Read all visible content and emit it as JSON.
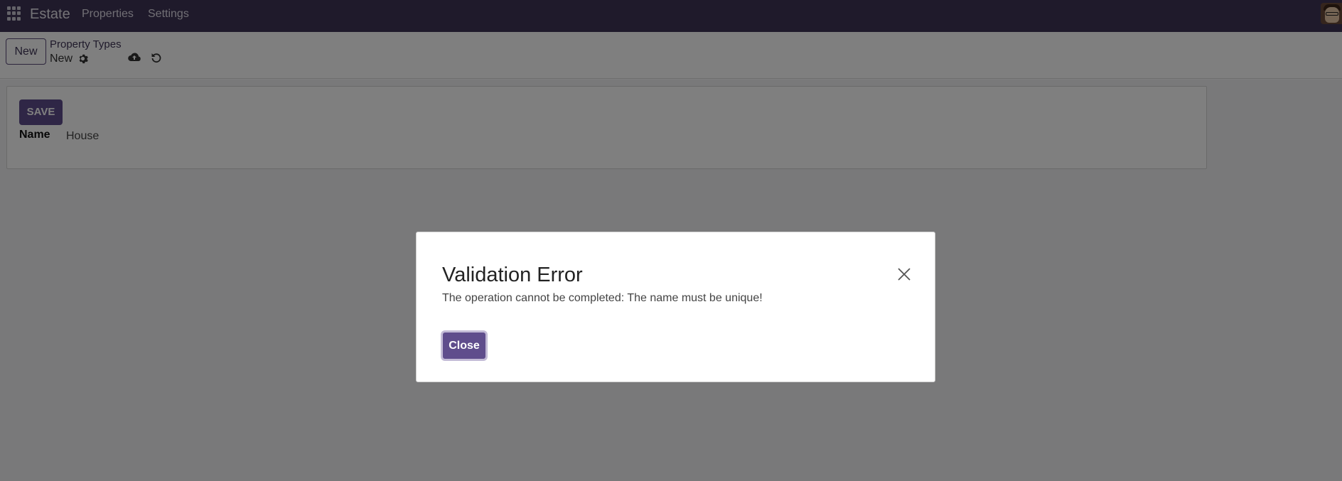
{
  "navbar": {
    "brand": "Estate",
    "menu": [
      "Properties",
      "Settings"
    ]
  },
  "control_panel": {
    "new_button": "New",
    "breadcrumb": "Property Types",
    "record_name": "New"
  },
  "form": {
    "save_button": "SAVE",
    "fields": [
      {
        "label": "Name",
        "value": "House"
      }
    ]
  },
  "dialog": {
    "title": "Validation Error",
    "message": "The operation cannot be completed: The name must be unique!",
    "close_button": "Close"
  },
  "colors": {
    "navbar": "#3f3556",
    "primary": "#5f4d8c",
    "backdrop": "rgba(0,0,0,0.5)"
  },
  "icons": [
    "apps-grid-icon",
    "gear-icon",
    "cloud-upload-icon",
    "undo-icon",
    "close-icon",
    "avatar"
  ]
}
